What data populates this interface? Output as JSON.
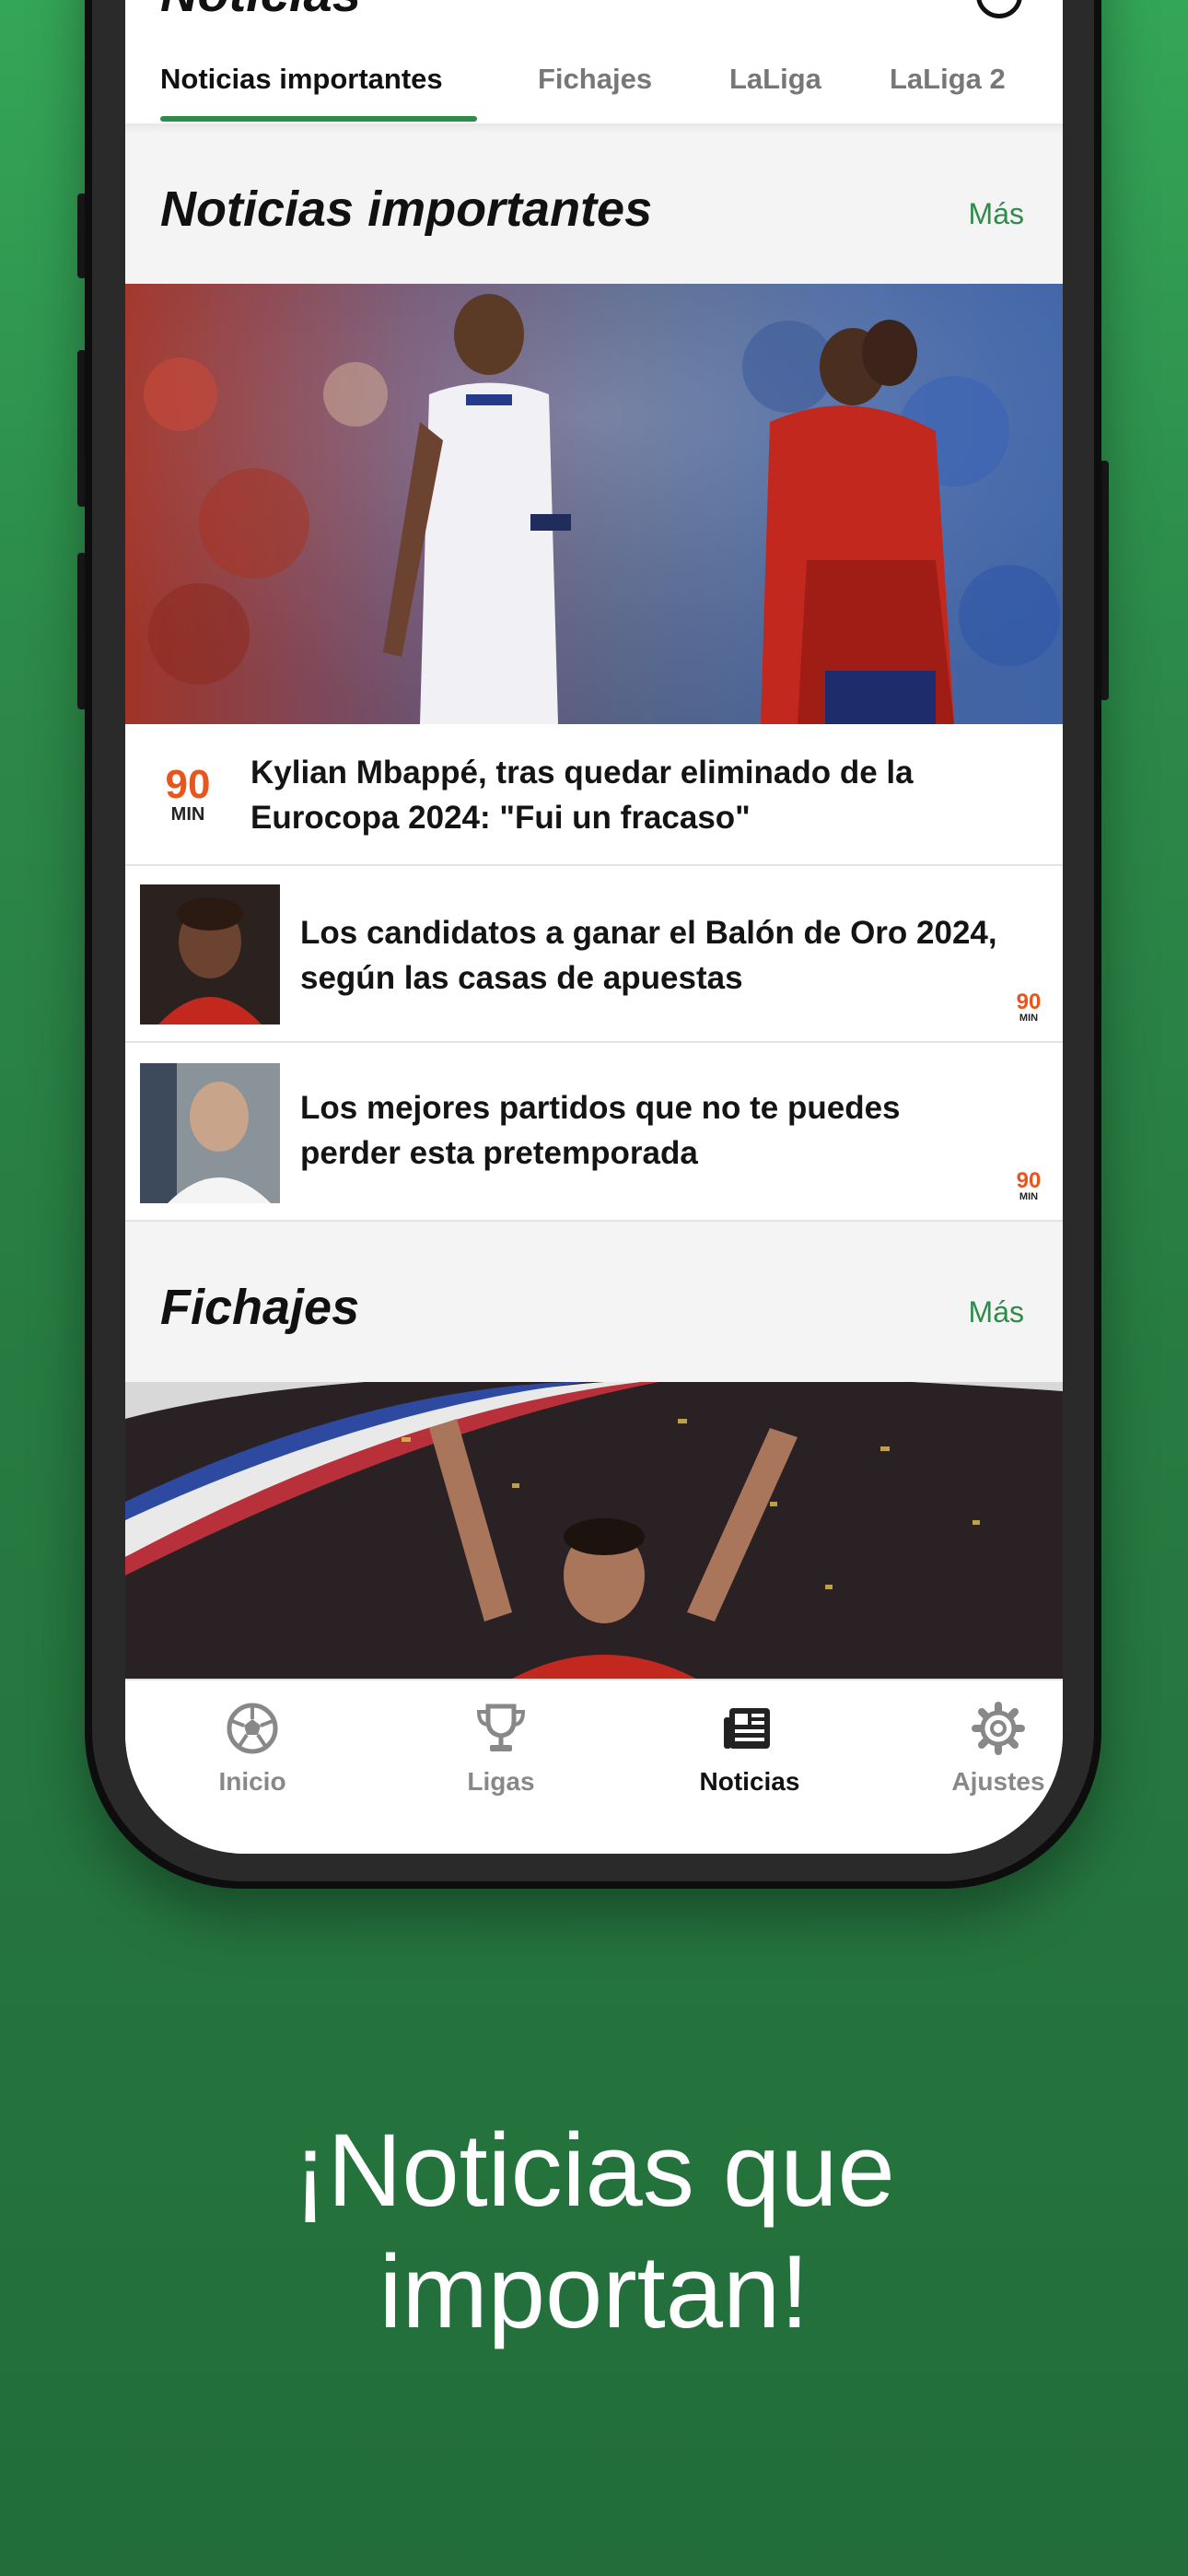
{
  "header": {
    "title": "Noticias"
  },
  "tabs": [
    {
      "label": "Noticias importantes"
    },
    {
      "label": "Fichajes"
    },
    {
      "label": "LaLiga"
    },
    {
      "label": "LaLiga 2"
    }
  ],
  "sections": {
    "important": {
      "title": "Noticias importantes",
      "more": "Más",
      "articles": [
        {
          "headline": "Kylian Mbappé, tras quedar eliminado de la Eurocopa 2024: \"Fui un fracaso\""
        },
        {
          "headline": "Los candidatos a ganar el Balón de Oro 2024, según las casas de apuestas"
        },
        {
          "headline": "Los mejores partidos que no te puedes perder esta pretemporada"
        }
      ]
    },
    "transfers": {
      "title": "Fichajes",
      "more": "Más"
    }
  },
  "source_logo": {
    "num": "90",
    "min": "MIN"
  },
  "bottom_nav": [
    {
      "label": "Inicio",
      "icon": "soccer-ball-icon"
    },
    {
      "label": "Ligas",
      "icon": "trophy-icon"
    },
    {
      "label": "Noticias",
      "icon": "newspaper-icon"
    },
    {
      "label": "Ajustes",
      "icon": "gear-icon"
    }
  ],
  "tagline": {
    "line1": "¡Noticias que",
    "line2": "importan!"
  },
  "colors": {
    "accent": "#2e8b4a",
    "logo": "#e8561e",
    "background": "#2c8a4a"
  }
}
